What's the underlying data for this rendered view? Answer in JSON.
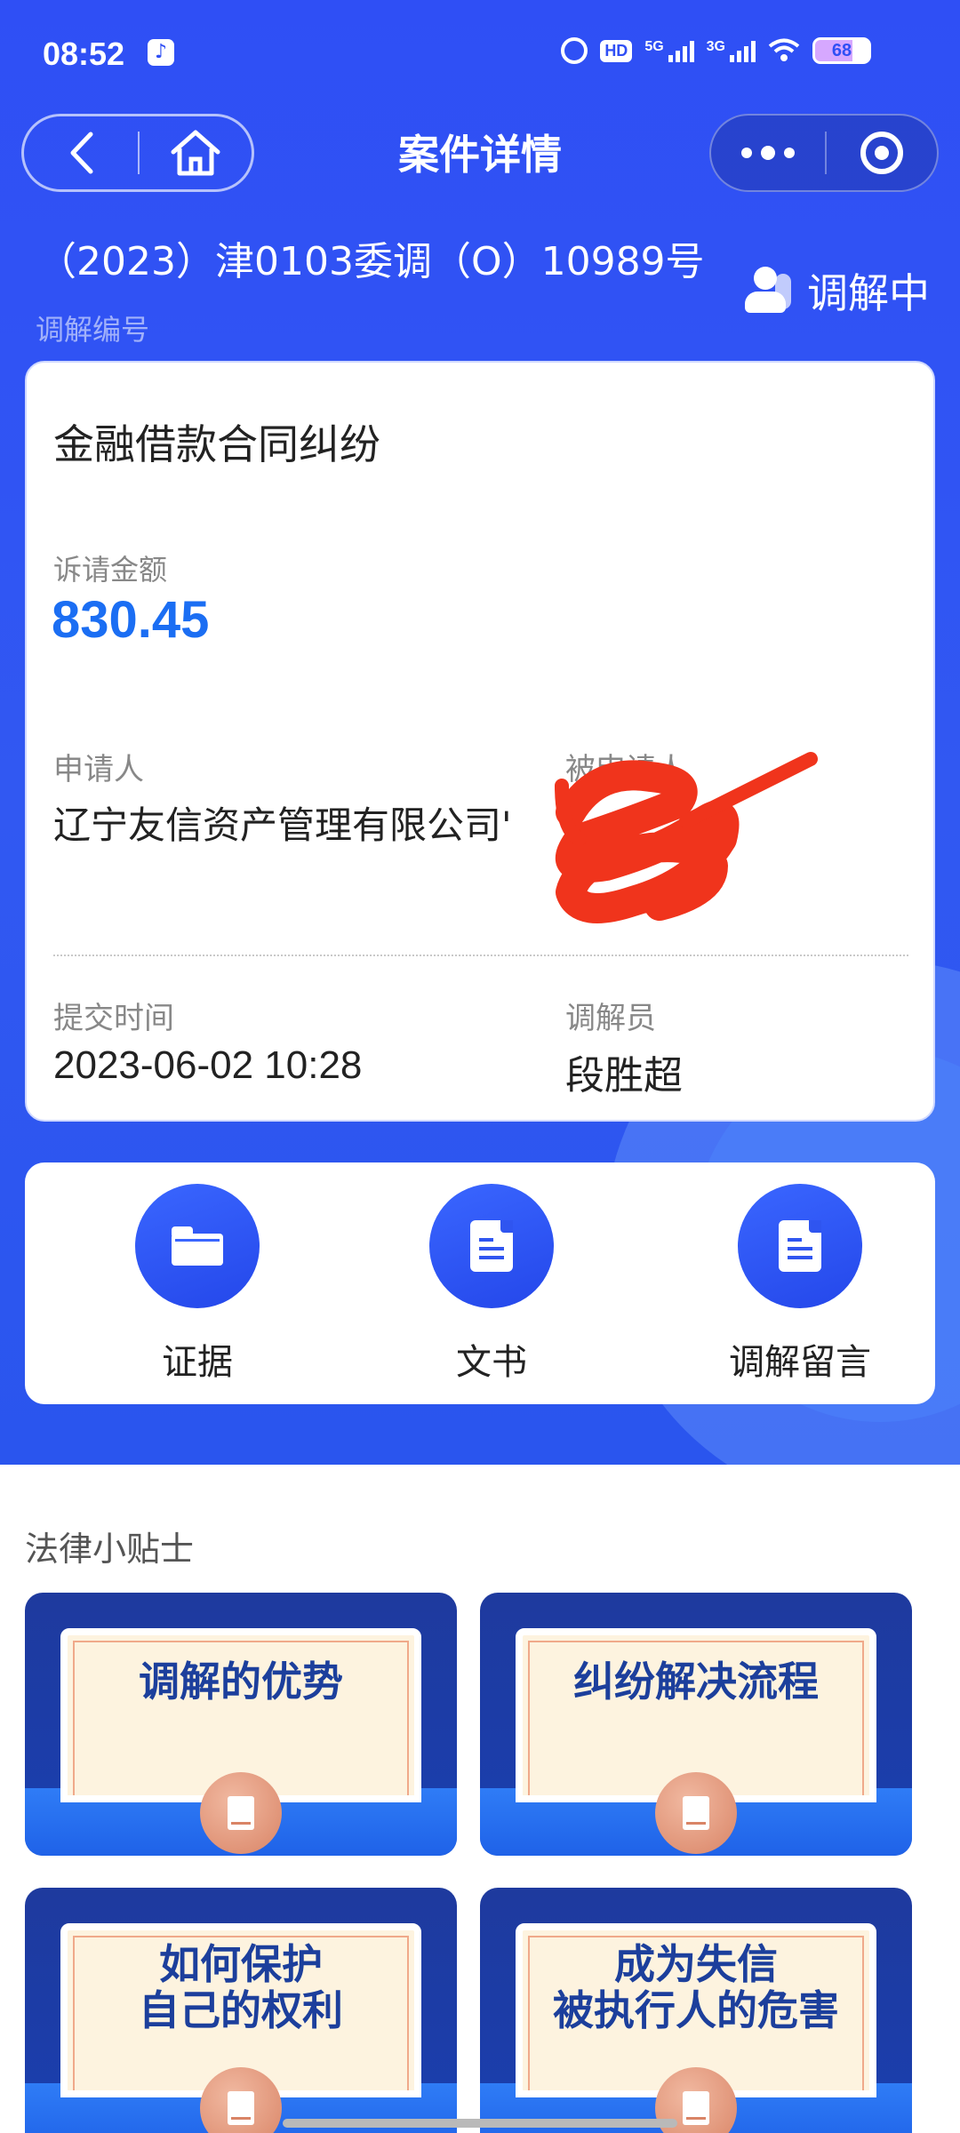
{
  "status_bar": {
    "time": "08:52",
    "hd": "HD",
    "net1": "5G",
    "net2": "3G",
    "battery": "68"
  },
  "nav": {
    "title": "案件详情"
  },
  "case": {
    "number": "（2023）津0103委调（O）10989号",
    "number_label": "调解编号",
    "status": "调解中"
  },
  "card": {
    "case_type": "金融借款合同纠纷",
    "amount_label": "诉请金额",
    "amount": "830.45",
    "applicant_label": "申请人",
    "applicant": "辽宁友信资产管理有限公司'",
    "respondent_label": "被申请人",
    "submit_label": "提交时间",
    "submit_time": "2023-06-02 10:28",
    "mediator_label": "调解员",
    "mediator": "段胜超"
  },
  "actions": [
    {
      "label": "证据",
      "icon": "folder-icon"
    },
    {
      "label": "文书",
      "icon": "document-icon"
    },
    {
      "label": "调解留言",
      "icon": "document-icon"
    }
  ],
  "tips": {
    "title": "法律小贴士",
    "items": [
      {
        "line1": "调解的优势",
        "line2": ""
      },
      {
        "line1": "纠纷解决流程",
        "line2": ""
      },
      {
        "line1": "如何保护",
        "line2": "自己的权利"
      },
      {
        "line1": "成为失信",
        "line2": "被执行人的危害"
      }
    ]
  },
  "colors": {
    "primary": "#2f4ff5",
    "amount": "#1b6ef3",
    "redaction": "#f0341c"
  }
}
